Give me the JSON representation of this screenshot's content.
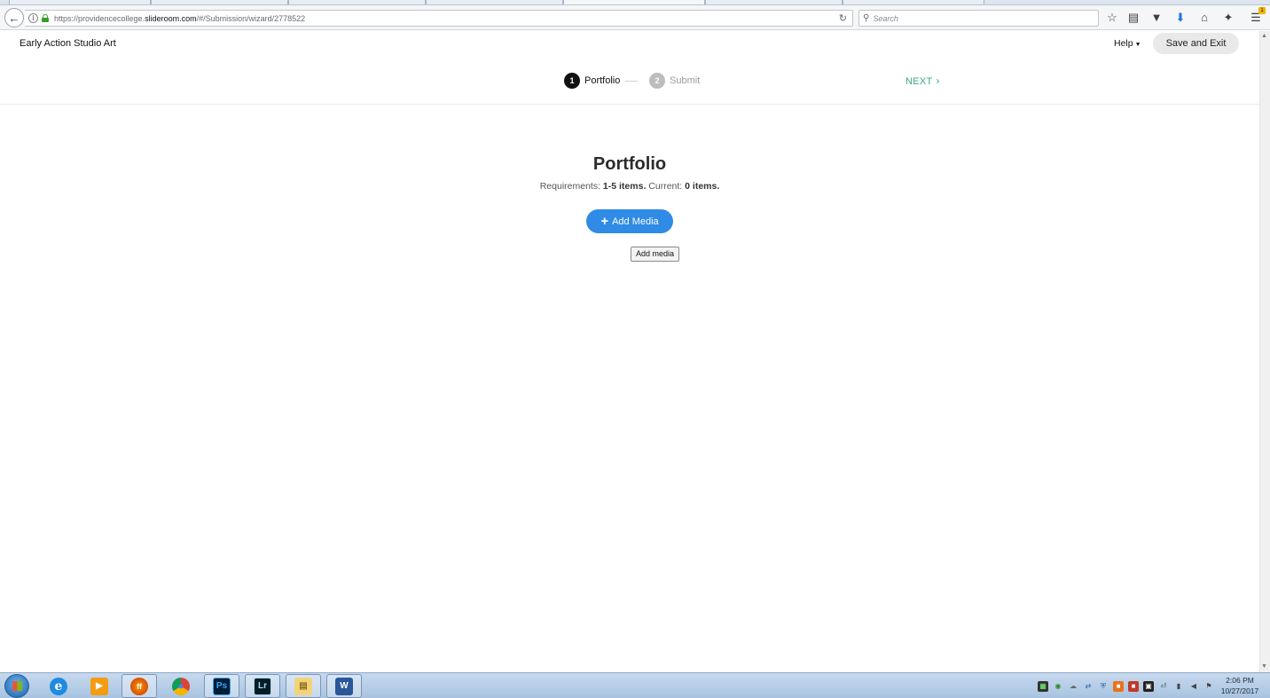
{
  "browser": {
    "url": {
      "prefix": "https://providencecollege.",
      "domain": "slideroom.com",
      "path": "/#/Submission/wizard/2778522"
    },
    "search_placeholder": "Search",
    "icons": [
      "back-icon",
      "info-icon",
      "lock-icon",
      "reload-icon",
      "search-icon",
      "bookmark-star-icon",
      "reading-list-icon",
      "pocket-icon",
      "download-icon",
      "home-icon",
      "extension-icon",
      "menu-icon"
    ],
    "menu_badge": "1"
  },
  "header": {
    "app_title": "Early Action Studio Art",
    "help_label": "Help",
    "save_exit_label": "Save and Exit"
  },
  "stepper": {
    "steps": [
      {
        "number": "1",
        "label": "Portfolio",
        "state": "active"
      },
      {
        "number": "2",
        "label": "Submit",
        "state": "inactive"
      }
    ],
    "next_label": "NEXT"
  },
  "main": {
    "heading": "Portfolio",
    "requirements_prefix": "Requirements:",
    "requirements_range": "1-5 items.",
    "current_prefix": "Current:",
    "current_count": "0 items.",
    "add_media_label": "Add Media",
    "tooltip": "Add media"
  },
  "taskbar": {
    "apps": [
      {
        "name": "internet-explorer",
        "glyph": "e"
      },
      {
        "name": "media-player",
        "glyph": "▶"
      },
      {
        "name": "firefox",
        "glyph": "ff"
      },
      {
        "name": "chrome",
        "glyph": "●"
      },
      {
        "name": "photoshop",
        "glyph": "Ps"
      },
      {
        "name": "lightroom",
        "glyph": "Lr"
      },
      {
        "name": "file-explorer",
        "glyph": "▤"
      },
      {
        "name": "word",
        "glyph": "W"
      }
    ],
    "clock_time": "2:06 PM",
    "clock_date": "10/27/2017"
  },
  "colors": {
    "accent_blue": "#2f8be6",
    "next_green": "#3aa982",
    "active_step": "#111111",
    "inactive_step": "#bdbdbd"
  }
}
